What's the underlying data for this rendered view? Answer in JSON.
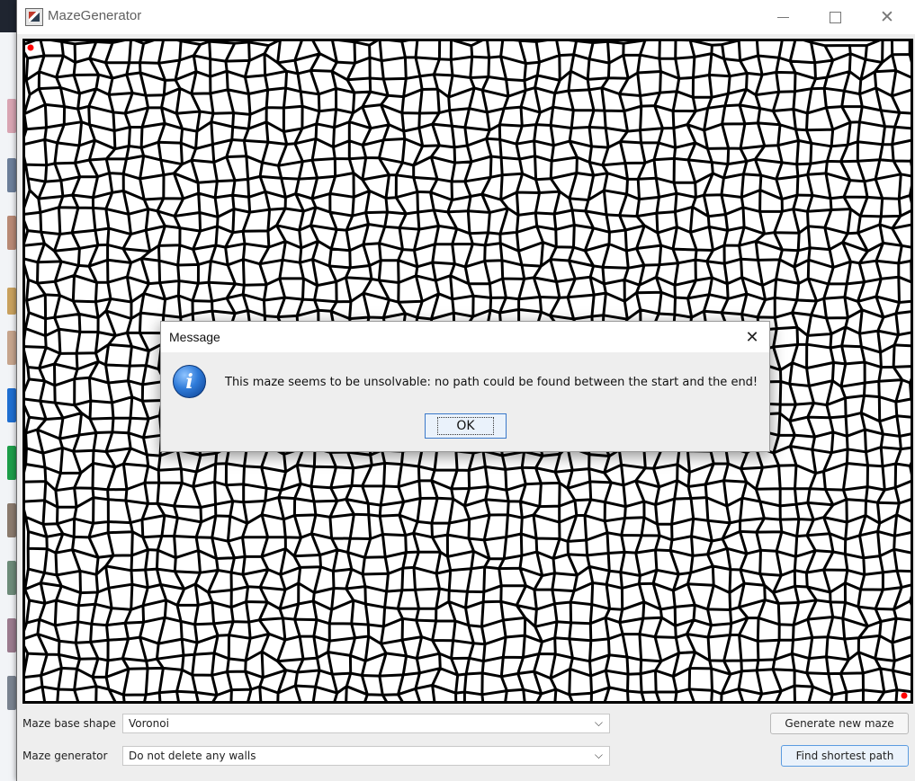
{
  "window": {
    "title": "MazeGenerator",
    "app_icon": "maze-app-icon",
    "controls": {
      "minimize_icon": "minimize-icon",
      "maximize_icon": "maximize-icon",
      "close_icon": "close-icon"
    }
  },
  "maze": {
    "base_shape": "Voronoi",
    "wall_color": "#000000",
    "background_color": "#ffffff",
    "start_marker_color": "#ff0000",
    "end_marker_color": "#ff0000"
  },
  "controls": {
    "shape_label": "Maze base shape",
    "shape_value": "Voronoi",
    "generator_label": "Maze generator",
    "generator_value": "Do not delete any walls",
    "generate_button": "Generate new maze",
    "shortest_path_button": "Find shortest path"
  },
  "dialog": {
    "title": "Message",
    "icon": "info-icon",
    "message": "This maze seems to be unsolvable: no path could be found between the start and the end!",
    "ok_label": "OK"
  }
}
